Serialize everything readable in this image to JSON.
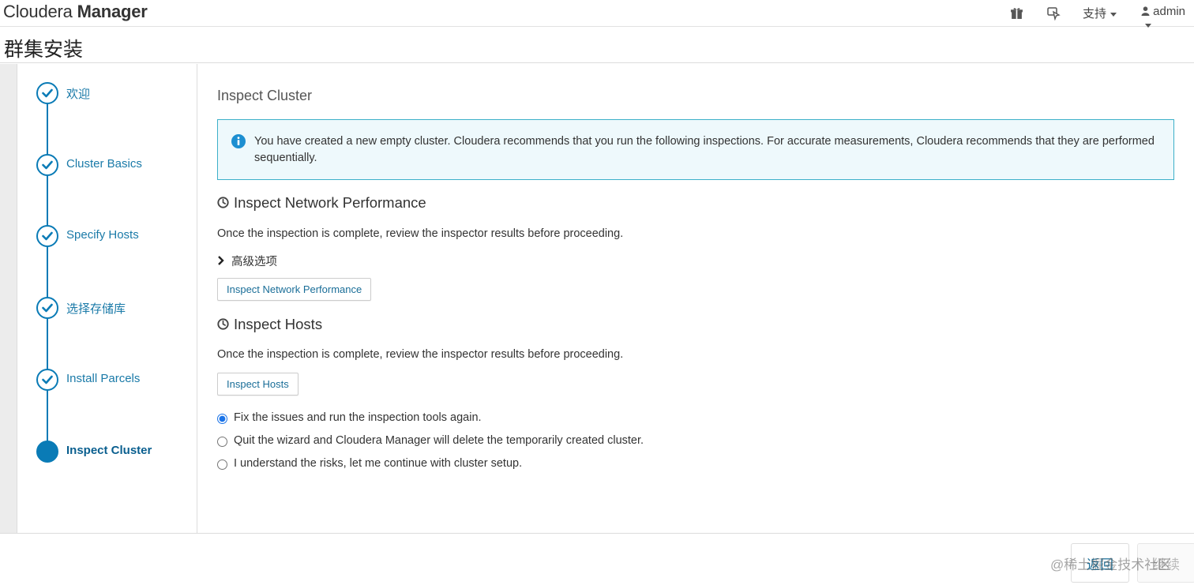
{
  "header": {
    "brand_light": "Cloudera ",
    "brand_bold": "Manager",
    "support_label": "支持",
    "user_label": "admin",
    "gift_icon": "gift-icon",
    "cursor_icon": "cursor-sparkle-icon"
  },
  "page": {
    "title": "群集安装"
  },
  "steps": [
    {
      "label": "欢迎",
      "status": "done"
    },
    {
      "label": "Cluster Basics",
      "status": "done"
    },
    {
      "label": "Specify Hosts",
      "status": "done"
    },
    {
      "label": "选择存储库",
      "status": "done"
    },
    {
      "label": "Install Parcels",
      "status": "done"
    },
    {
      "label": "Inspect Cluster",
      "status": "active"
    }
  ],
  "main": {
    "section_title": "Inspect Cluster",
    "info_text": "You have created a new empty cluster. Cloudera recommends that you run the following inspections. For accurate measurements, Cloudera recommends that they are performed sequentially.",
    "network": {
      "heading": "Inspect Network Performance",
      "desc": "Once the inspection is complete, review the inspector results before proceeding.",
      "advanced_label": "高级选项",
      "button_label": "Inspect Network Performance"
    },
    "hosts": {
      "heading": "Inspect Hosts",
      "desc": "Once the inspection is complete, review the inspector results before proceeding.",
      "button_label": "Inspect Hosts"
    },
    "options": [
      {
        "label": "Fix the issues and run the inspection tools again.",
        "checked": true
      },
      {
        "label": "Quit the wizard and Cloudera Manager will delete the temporarily created cluster.",
        "checked": false
      },
      {
        "label": "I understand the risks, let me continue with cluster setup.",
        "checked": false
      }
    ]
  },
  "footer": {
    "back_label": "返回",
    "next_label": "继续",
    "watermark": "@稀土掘金技术社区"
  },
  "colors": {
    "accent": "#0a7bb6",
    "info_border": "#3cb0c9",
    "info_bg": "#eef9fc"
  }
}
